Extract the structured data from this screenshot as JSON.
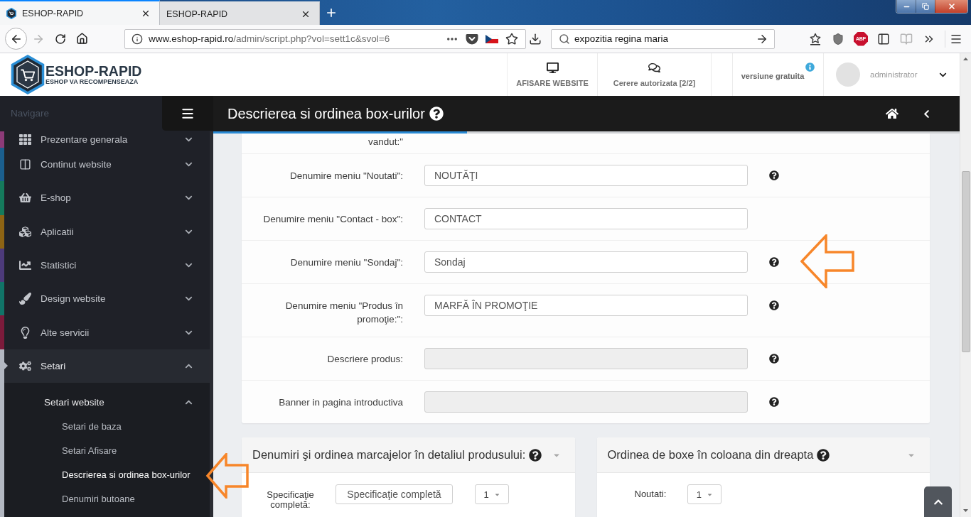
{
  "browser": {
    "tabs": [
      {
        "title": "ESHOP-RAPID",
        "favicon": true,
        "selected": true
      },
      {
        "title": "ESHOP-RAPID",
        "favicon": false,
        "selected": false
      }
    ],
    "forward_disabled": true,
    "address": {
      "host": "www.eshop-rapid.ro",
      "path": "/admin/script.php?vol=sett1c&svol=6"
    },
    "search": {
      "value": "expozitia regina maria"
    },
    "adblock_badge": "ABP",
    "reader_disabled": true
  },
  "header": {
    "logo": {
      "name": "ESHOP-RAPID",
      "tagline": "ESHOP VA RECOMPENSEAZA"
    },
    "actions": [
      {
        "kind": "monitor",
        "label": "AFISARE WEBSITE"
      },
      {
        "kind": "chat",
        "label": "Cerere autorizata [2/2]"
      }
    ],
    "version": "versiune gratuita",
    "user": "administrator"
  },
  "sidebar": {
    "title": "Navigare",
    "items": [
      {
        "label": "Prezentare generala",
        "color": "#8c3b78",
        "selected": false,
        "expanded": false
      },
      {
        "label": "Continut website",
        "color": "#1b5f8e",
        "selected": false,
        "expanded": false
      },
      {
        "label": "E-shop",
        "color": "#157a5c",
        "selected": false,
        "expanded": false
      },
      {
        "label": "Aplicatii",
        "color": "#8d6414",
        "selected": false,
        "expanded": false
      },
      {
        "label": "Statistici",
        "color": "#4d3b7b",
        "selected": false,
        "expanded": false
      },
      {
        "label": "Design website",
        "color": "#117468",
        "selected": false,
        "expanded": false
      },
      {
        "label": "Alte servicii",
        "color": "#7c1b3b",
        "selected": false,
        "expanded": false
      },
      {
        "label": "Setari",
        "color": "#b3b8c2",
        "selected": true,
        "expanded": true,
        "children": [
          {
            "label": "Setari website",
            "expanded": true,
            "children": [
              {
                "label": "Setari de baza",
                "selected": false
              },
              {
                "label": "Setari Afisare",
                "selected": false
              },
              {
                "label": "Descrierea si ordinea box-urilor",
                "selected": true
              },
              {
                "label": "Denumiri butoane",
                "selected": false
              }
            ]
          }
        ]
      }
    ]
  },
  "page": {
    "title": "Descrierea si ordinea box-urilor",
    "progress": {
      "level": 0.34
    }
  },
  "form": {
    "rows": [
      {
        "kind": "label",
        "label": "vandut:\""
      },
      {
        "kind": "input",
        "label": "Denumire meniu \"Noutati\":",
        "value": "NOUTĂŢI",
        "disabled": false,
        "help": true
      },
      {
        "kind": "input",
        "label": "Denumire meniu \"Contact - box\":",
        "value": "CONTACT",
        "disabled": false,
        "help": false
      },
      {
        "kind": "input",
        "label": "Denumire meniu \"Sondaj\":",
        "value": "Sondaj",
        "disabled": false,
        "help": true
      },
      {
        "kind": "input",
        "label": "Denumire meniu \"Produs în promoţie:\":",
        "value": "MARFĂ ÎN PROMOŢIE",
        "disabled": false,
        "help": true
      },
      {
        "kind": "input",
        "label": "Descriere produs:",
        "disabled": true,
        "help": true
      },
      {
        "kind": "input",
        "label": "Banner in pagina introductiva",
        "disabled": true,
        "help": true
      }
    ]
  },
  "panels": [
    {
      "title": "Denumiri şi ordinea marcajelor în detaliul produsului:",
      "help": true,
      "rows": [
        {
          "kind": "field-select",
          "label": "Specificaţie completă:",
          "value": "Specificaţie completă",
          "order": "1"
        }
      ]
    },
    {
      "title": "Ordinea de boxe în coloana din dreapta",
      "help": true,
      "rows": [
        {
          "kind": "select",
          "label": "Noutati:",
          "order": "1"
        }
      ]
    }
  ]
}
